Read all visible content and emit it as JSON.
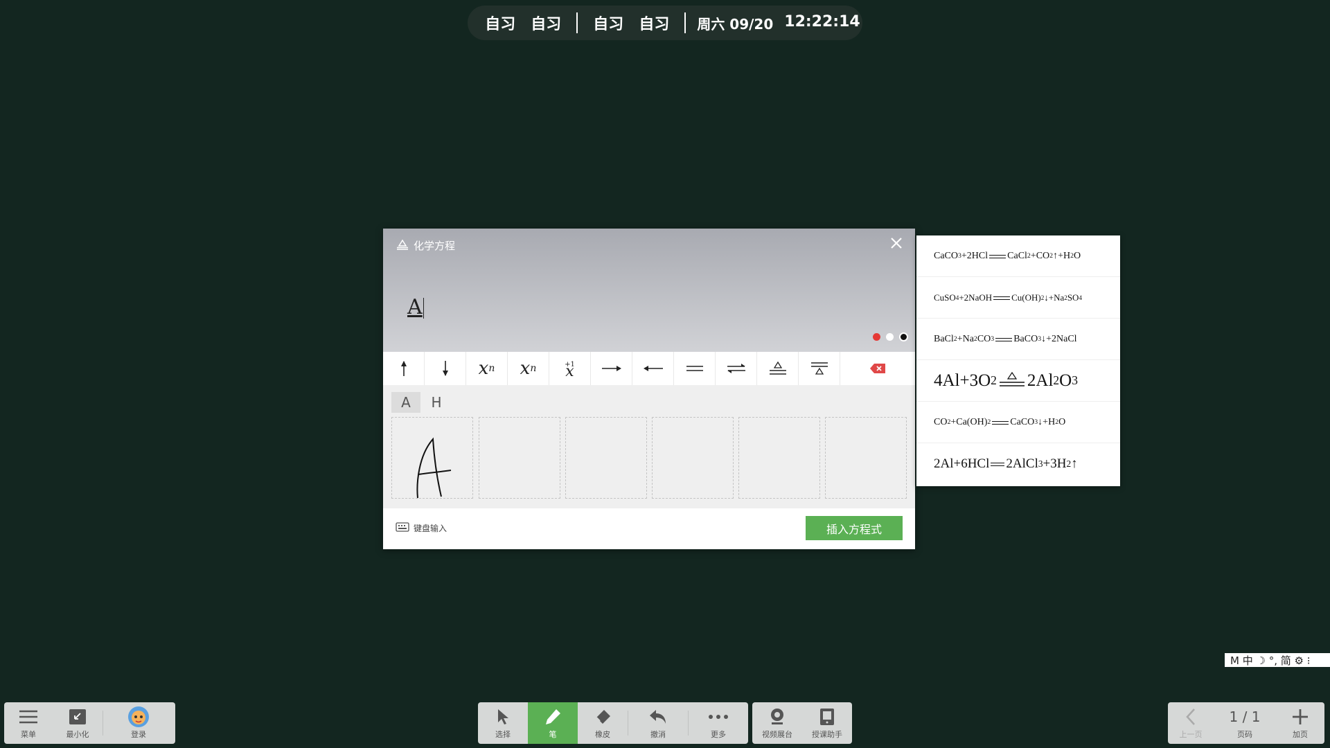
{
  "topbar": {
    "lesson1": "自习",
    "lesson2": "自习",
    "lesson3": "自习",
    "lesson4": "自习",
    "weekday_date": "周六 09/20",
    "time": "12:22:14"
  },
  "dialog": {
    "title": "化学方程",
    "title_icon": "triangle-over-bar-icon",
    "close_icon": "close-icon",
    "preview_text": "A",
    "page_dots": [
      "#e53935",
      "#ffffff",
      "#111111"
    ],
    "symbols": [
      {
        "name": "up-arrow",
        "label": "↑"
      },
      {
        "name": "down-arrow",
        "label": "↓"
      },
      {
        "name": "superscript",
        "label": "xⁿ"
      },
      {
        "name": "subscript",
        "label": "xₙ"
      },
      {
        "name": "valence",
        "label": "x"
      },
      {
        "name": "right-arrow",
        "label": "⟶"
      },
      {
        "name": "left-arrow",
        "label": "⟵"
      },
      {
        "name": "equals",
        "label": "═"
      },
      {
        "name": "reversible",
        "label": "⇌"
      },
      {
        "name": "heating-condition",
        "label": "≜"
      },
      {
        "name": "condition-below",
        "label": "⩮"
      }
    ],
    "delete_icon": "backspace-icon",
    "candidates": [
      "A",
      "H"
    ],
    "handwriting_cells": 6,
    "keyboard_label": "键盘输入",
    "insert_label": "插入方程式"
  },
  "equations": [
    "CaCO3+2HCl═CaCl2+CO2↑+H2O",
    "CuSO4+2NaOH═Cu(OH)2↓+Na2SO4",
    "BaCl2+Na2CO3═BaCO3↓+2NaCl",
    "4Al+3O2 △ 2Al2O3",
    "CO2+Ca(OH)2═CaCO3↓+H2O",
    "2Al+6HCl═2AlCl3+3H2↑"
  ],
  "ime": {
    "text": "M 中 ☽ °, 简 ⚙ ⁝"
  },
  "left_toolbar": {
    "menu": "菜单",
    "minimize": "最小化",
    "login": "登录"
  },
  "center_toolbar": {
    "select": "选择",
    "pen": "笔",
    "eraser": "橡皮",
    "undo": "撤消",
    "more": "更多"
  },
  "tools_toolbar": {
    "video": "视频展台",
    "assistant": "授课助手"
  },
  "page_toolbar": {
    "prev": "上一页",
    "page_value": "1 / 1",
    "page_label": "页码",
    "add": "加页"
  }
}
